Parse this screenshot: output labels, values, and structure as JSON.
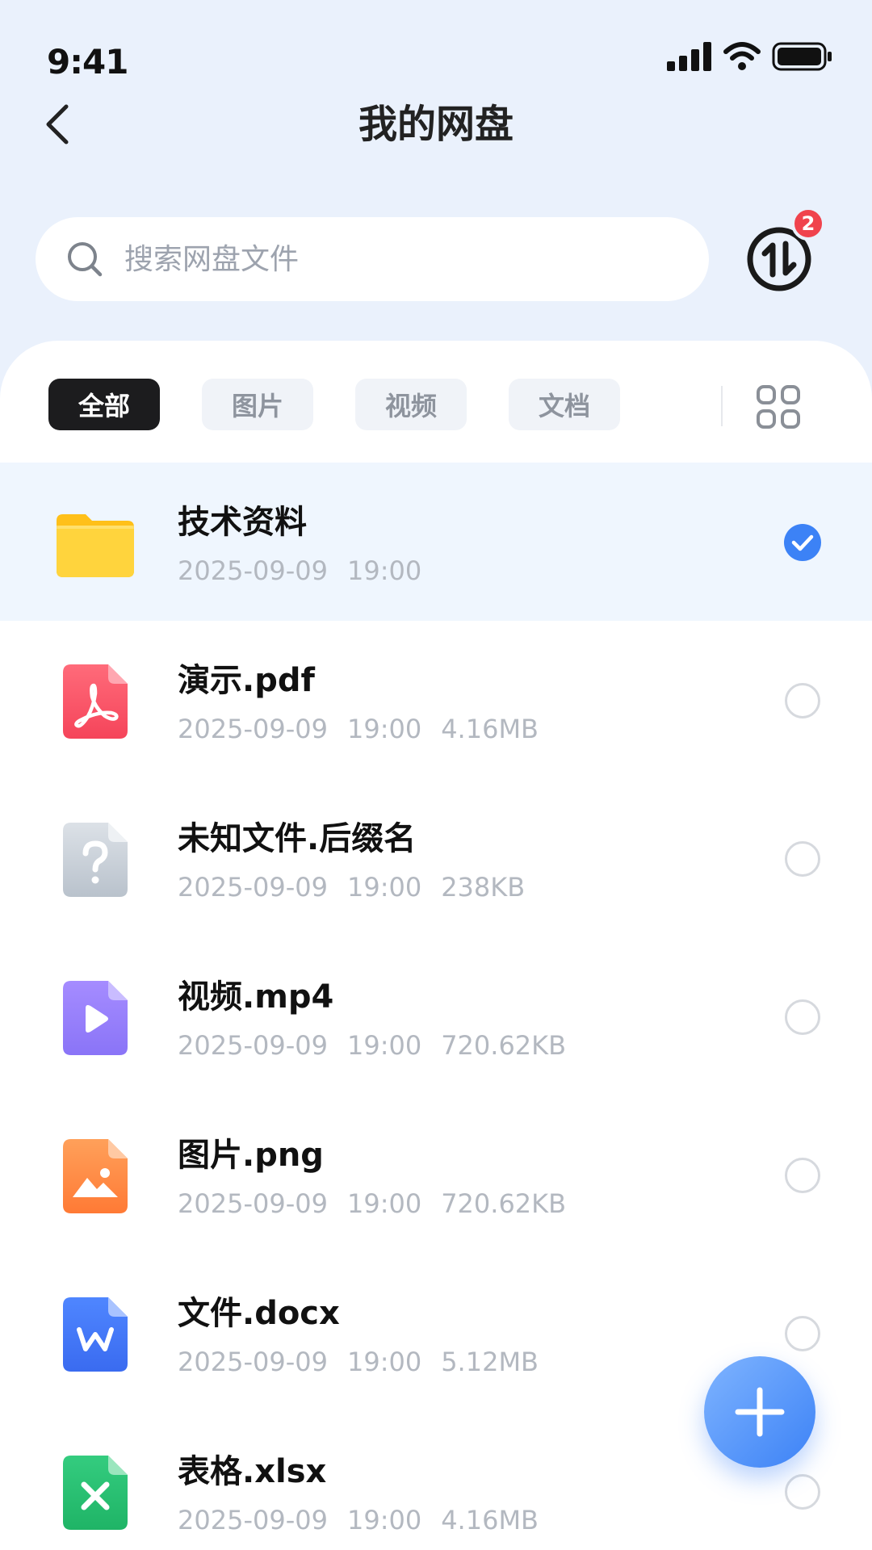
{
  "status_bar": {
    "time": "9:41",
    "icons": [
      "signal-icon",
      "wifi-icon",
      "battery-icon"
    ]
  },
  "header": {
    "title": "我的网盘",
    "back_icon": "chevron-left-icon"
  },
  "search": {
    "placeholder": "搜索网盘文件",
    "value": "",
    "icon": "search-icon"
  },
  "transfer": {
    "icon": "transfer-icon",
    "badge_count": "2",
    "badge_color": "#F0434D"
  },
  "tabs": [
    {
      "label": "全部",
      "active": true
    },
    {
      "label": "图片",
      "active": false
    },
    {
      "label": "视频",
      "active": false
    },
    {
      "label": "文档",
      "active": false
    }
  ],
  "view_toggle_icon": "grid-view-icon",
  "files": [
    {
      "name": "技术资料",
      "date": "2025-09-09",
      "time": "19:00",
      "size": "",
      "type": "folder",
      "icon": "folder-icon",
      "selected": true
    },
    {
      "name": "演示.pdf",
      "date": "2025-09-09",
      "time": "19:00",
      "size": "4.16MB",
      "type": "pdf",
      "icon": "pdf-file-icon",
      "selected": false
    },
    {
      "name": "未知文件.后缀名",
      "date": "2025-09-09",
      "time": "19:00",
      "size": "238KB",
      "type": "unknown",
      "icon": "unknown-file-icon",
      "selected": false
    },
    {
      "name": "视频.mp4",
      "date": "2025-09-09",
      "time": "19:00",
      "size": "720.62KB",
      "type": "video",
      "icon": "video-file-icon",
      "selected": false
    },
    {
      "name": "图片.png",
      "date": "2025-09-09",
      "time": "19:00",
      "size": "720.62KB",
      "type": "image",
      "icon": "image-file-icon",
      "selected": false
    },
    {
      "name": "文件.docx",
      "date": "2025-09-09",
      "time": "19:00",
      "size": "5.12MB",
      "type": "word",
      "icon": "word-file-icon",
      "selected": false
    },
    {
      "name": "表格.xlsx",
      "date": "2025-09-09",
      "time": "19:00",
      "size": "4.16MB",
      "type": "excel",
      "icon": "excel-file-icon",
      "selected": false
    }
  ],
  "colors": {
    "accent": "#3C82F6",
    "background": "#EAF1FC",
    "selected_row": "#EFF6FE",
    "active_tab": "#1C1C1E"
  },
  "fab": {
    "icon": "plus-icon"
  }
}
